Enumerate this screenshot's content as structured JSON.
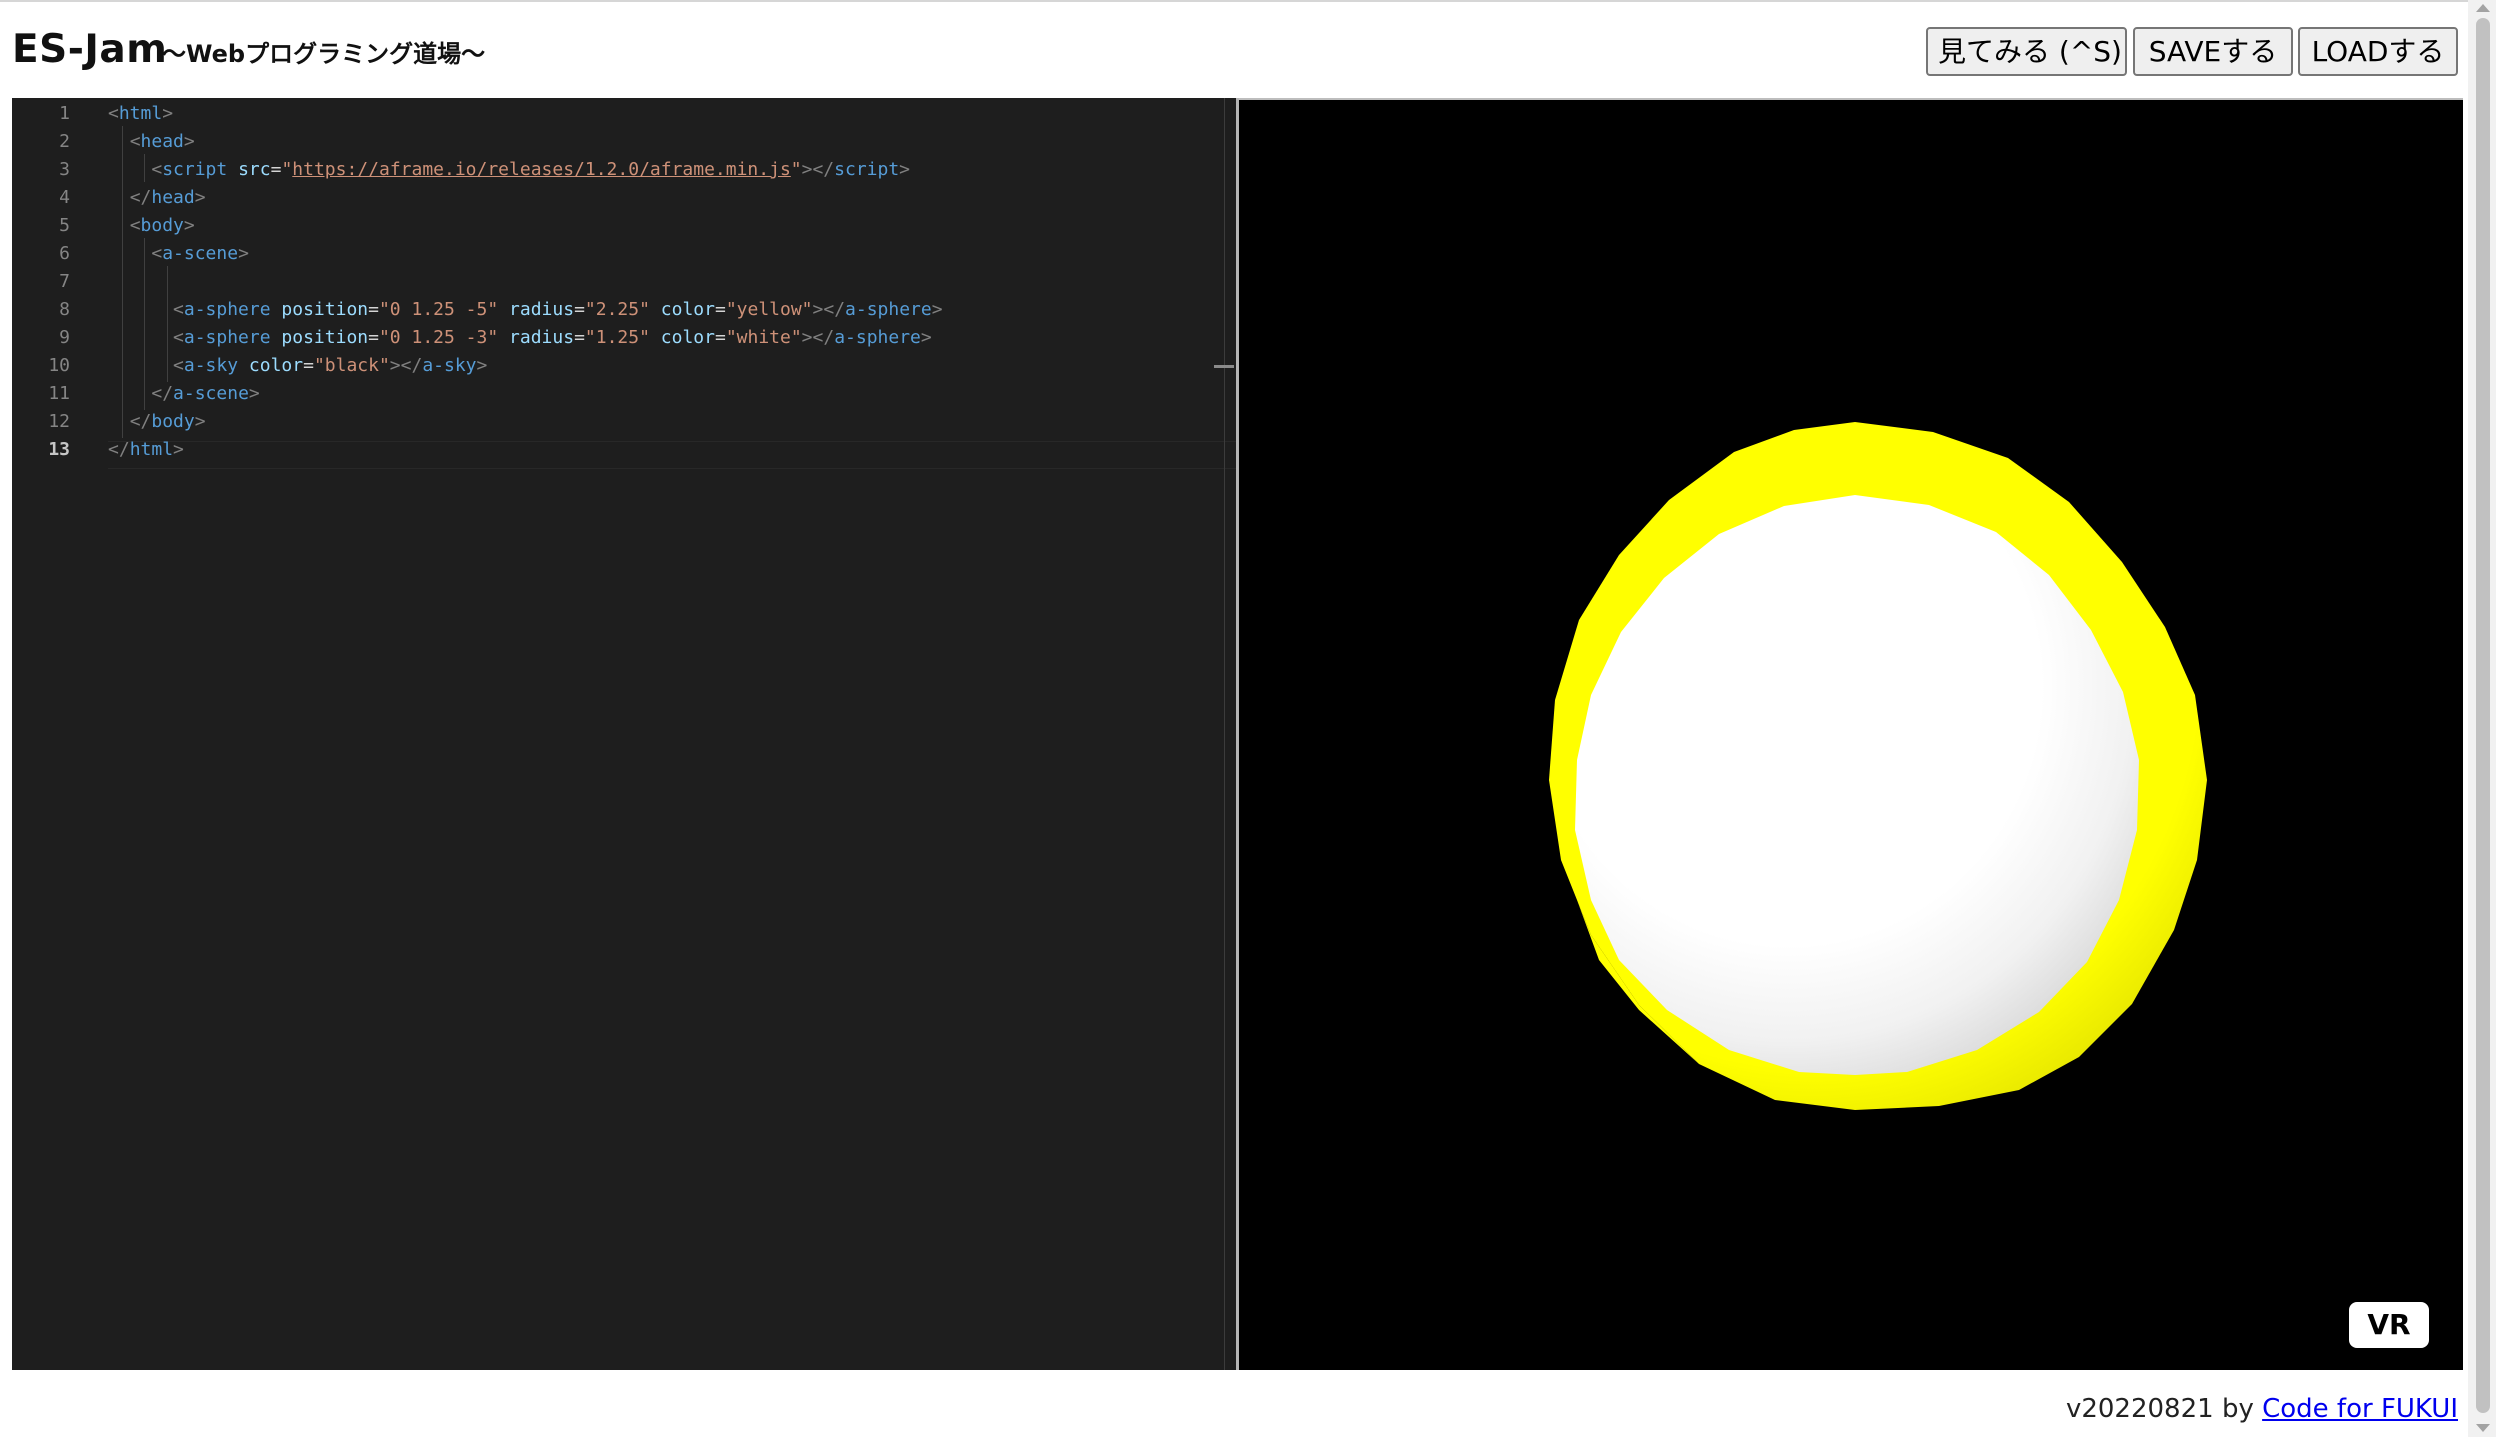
{
  "header": {
    "title": "ES-Jam",
    "subtitle": "〜Webプログラミング道場〜"
  },
  "toolbar": {
    "view_label": "見てみる (^S)",
    "save_label": "SAVEする",
    "load_label": "LOADする"
  },
  "editor": {
    "line_numbers": [
      "1",
      "2",
      "3",
      "4",
      "5",
      "6",
      "7",
      "8",
      "9",
      "10",
      "11",
      "12",
      "13"
    ],
    "active_line": "13",
    "lines": [
      [
        [
          "punc",
          "<"
        ],
        [
          "tag",
          "html"
        ],
        [
          "punc",
          ">"
        ]
      ],
      [
        [
          "sp",
          "  "
        ],
        [
          "punc",
          "<"
        ],
        [
          "tag",
          "head"
        ],
        [
          "punc",
          ">"
        ]
      ],
      [
        [
          "sp",
          "    "
        ],
        [
          "punc",
          "<"
        ],
        [
          "tag",
          "script"
        ],
        [
          "sp",
          " "
        ],
        [
          "attr",
          "src"
        ],
        [
          "eq",
          "="
        ],
        [
          "str",
          "\""
        ],
        [
          "url",
          "https://aframe.io/releases/1.2.0/aframe.min.js"
        ],
        [
          "str",
          "\""
        ],
        [
          "punc",
          "></"
        ],
        [
          "tag",
          "script"
        ],
        [
          "punc",
          ">"
        ]
      ],
      [
        [
          "sp",
          "  "
        ],
        [
          "punc",
          "</"
        ],
        [
          "tag",
          "head"
        ],
        [
          "punc",
          ">"
        ]
      ],
      [
        [
          "sp",
          "  "
        ],
        [
          "punc",
          "<"
        ],
        [
          "tag",
          "body"
        ],
        [
          "punc",
          ">"
        ]
      ],
      [
        [
          "sp",
          "    "
        ],
        [
          "punc",
          "<"
        ],
        [
          "tag",
          "a-scene"
        ],
        [
          "punc",
          ">"
        ]
      ],
      [],
      [
        [
          "sp",
          "      "
        ],
        [
          "punc",
          "<"
        ],
        [
          "tag",
          "a-sphere"
        ],
        [
          "sp",
          " "
        ],
        [
          "attr",
          "position"
        ],
        [
          "eq",
          "="
        ],
        [
          "str",
          "\"0 1.25 -5\""
        ],
        [
          "sp",
          " "
        ],
        [
          "attr",
          "radius"
        ],
        [
          "eq",
          "="
        ],
        [
          "str",
          "\"2.25\""
        ],
        [
          "sp",
          " "
        ],
        [
          "attr",
          "color"
        ],
        [
          "eq",
          "="
        ],
        [
          "str",
          "\"yellow\""
        ],
        [
          "punc",
          "></"
        ],
        [
          "tag",
          "a-sphere"
        ],
        [
          "punc",
          ">"
        ]
      ],
      [
        [
          "sp",
          "      "
        ],
        [
          "punc",
          "<"
        ],
        [
          "tag",
          "a-sphere"
        ],
        [
          "sp",
          " "
        ],
        [
          "attr",
          "position"
        ],
        [
          "eq",
          "="
        ],
        [
          "str",
          "\"0 1.25 -3\""
        ],
        [
          "sp",
          " "
        ],
        [
          "attr",
          "radius"
        ],
        [
          "eq",
          "="
        ],
        [
          "str",
          "\"1.25\""
        ],
        [
          "sp",
          " "
        ],
        [
          "attr",
          "color"
        ],
        [
          "eq",
          "="
        ],
        [
          "str",
          "\"white\""
        ],
        [
          "punc",
          "></"
        ],
        [
          "tag",
          "a-sphere"
        ],
        [
          "punc",
          ">"
        ]
      ],
      [
        [
          "sp",
          "      "
        ],
        [
          "punc",
          "<"
        ],
        [
          "tag",
          "a-sky"
        ],
        [
          "sp",
          " "
        ],
        [
          "attr",
          "color"
        ],
        [
          "eq",
          "="
        ],
        [
          "str",
          "\"black\""
        ],
        [
          "punc",
          "></"
        ],
        [
          "tag",
          "a-sky"
        ],
        [
          "punc",
          ">"
        ]
      ],
      [
        [
          "sp",
          "    "
        ],
        [
          "punc",
          "</"
        ],
        [
          "tag",
          "a-scene"
        ],
        [
          "punc",
          ">"
        ]
      ],
      [
        [
          "sp",
          "  "
        ],
        [
          "punc",
          "</"
        ],
        [
          "tag",
          "body"
        ],
        [
          "punc",
          ">"
        ]
      ],
      [
        [
          "punc",
          "</"
        ],
        [
          "tag",
          "html"
        ],
        [
          "punc",
          ">"
        ]
      ]
    ]
  },
  "preview": {
    "vr_label": "VR",
    "sky_color": "#000000",
    "back_sphere_color": "#ffff00",
    "front_sphere_color": "#ffffff"
  },
  "footer": {
    "version": "v20220821 by ",
    "link_text": "Code for FUKUI"
  }
}
